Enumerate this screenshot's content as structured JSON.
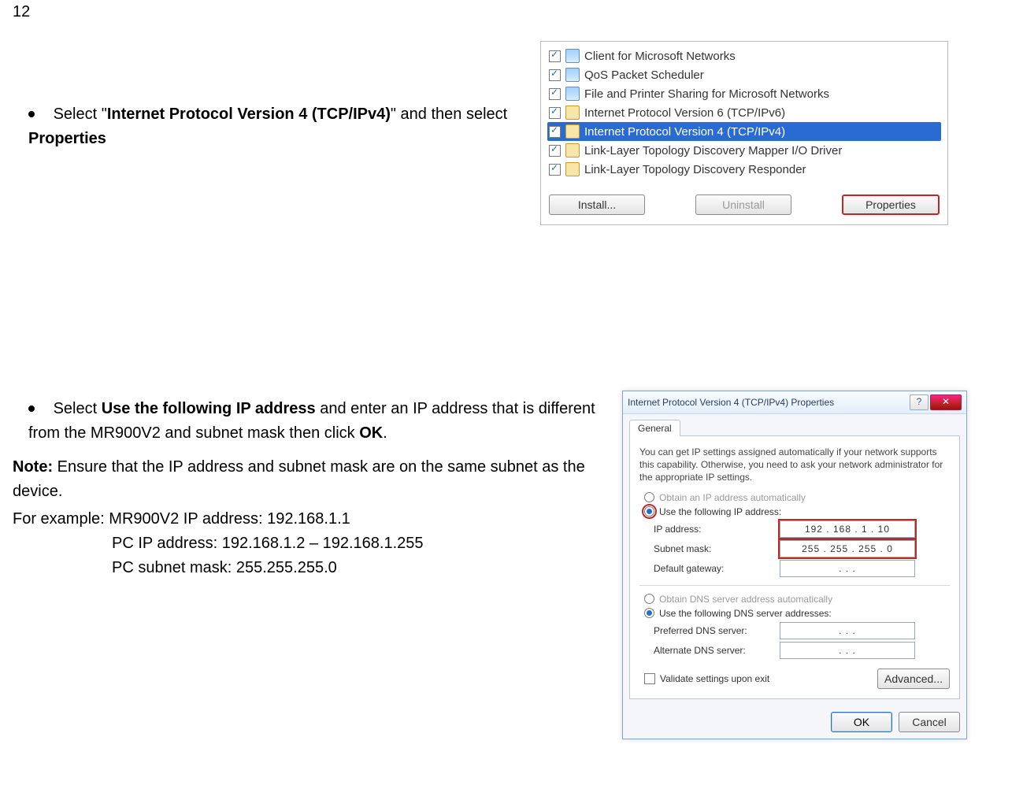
{
  "page_number": "12",
  "step1": {
    "pre": "Select \"",
    "bold1": "Internet Protocol Version 4 (TCP/IPv4)",
    "mid": "\" and then select ",
    "bold2": "Properties"
  },
  "panel1": {
    "items": [
      {
        "label": "Client for Microsoft Networks",
        "icon": "mon"
      },
      {
        "label": "QoS Packet Scheduler",
        "icon": "mon"
      },
      {
        "label": "File and Printer Sharing for Microsoft Networks",
        "icon": "mon"
      },
      {
        "label": "Internet Protocol Version 6 (TCP/IPv6)",
        "icon": "net"
      },
      {
        "label": "Internet Protocol Version 4 (TCP/IPv4)",
        "icon": "net",
        "selected": true
      },
      {
        "label": "Link-Layer Topology Discovery Mapper I/O Driver",
        "icon": "net"
      },
      {
        "label": "Link-Layer Topology Discovery Responder",
        "icon": "net"
      }
    ],
    "buttons": {
      "install": "Install...",
      "uninstall": "Uninstall",
      "properties": "Properties"
    }
  },
  "step2": {
    "line1_pre": "Select ",
    "line1_bold": "Use the following IP address",
    "line1_post": " and enter an IP address that is different from the MR900V2 and subnet mask then click ",
    "line1_bold2": "OK",
    "line1_end": ".",
    "note_label": "Note:",
    "note_text": " Ensure that the IP address and subnet mask are on the same subnet as the device.",
    "example_label": "For example:",
    "ex1": "MR900V2 IP address: 192.168.1.1",
    "ex2": "PC IP address: 192.168.1.2 – 192.168.1.255",
    "ex3": "PC subnet mask: 255.255.255.0"
  },
  "panel2": {
    "title": "Internet Protocol Version 4 (TCP/IPv4) Properties",
    "help": "?",
    "close": "✕",
    "tab": "General",
    "intro": "You can get IP settings assigned automatically if your network supports this capability. Otherwise, you need to ask your network administrator for the appropriate IP settings.",
    "r_auto_ip": "Obtain an IP address automatically",
    "r_use_ip": "Use the following IP address:",
    "k_ip": "IP address:",
    "v_ip": "192 . 168 .  1  .  10",
    "k_mask": "Subnet mask:",
    "v_mask": "255 . 255 . 255 .  0",
    "k_gw": "Default gateway:",
    "v_gw": ".       .       .",
    "r_auto_dns": "Obtain DNS server address automatically",
    "r_use_dns": "Use the following DNS server addresses:",
    "k_pdns": "Preferred DNS server:",
    "v_pdns": ".       .       .",
    "k_adns": "Alternate DNS server:",
    "v_adns": ".       .       .",
    "validate": "Validate settings upon exit",
    "advanced": "Advanced...",
    "ok": "OK",
    "cancel": "Cancel"
  }
}
